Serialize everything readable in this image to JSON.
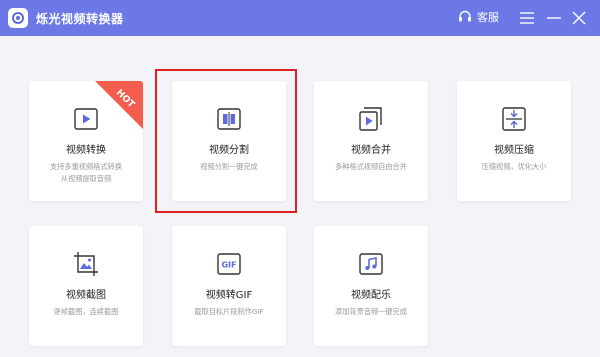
{
  "app": {
    "title": "烁光视频转换器"
  },
  "titlebar": {
    "support_label": "客服"
  },
  "tools": [
    {
      "name": "视频转换",
      "desc": "支持多重视频格式转换\n从视频提取音频",
      "badge": "HOT"
    },
    {
      "name": "视频分割",
      "desc": "视频分割一键完成"
    },
    {
      "name": "视频合并",
      "desc": "多种格式视频自由合并"
    },
    {
      "name": "视频压缩",
      "desc": "压缩视频，优化大小"
    },
    {
      "name": "视频截图",
      "desc": "逐帧截图，连续截图"
    },
    {
      "name": "视频转GIF",
      "desc": "截取目标片段制作GIF",
      "icon_text": "GIF"
    },
    {
      "name": "视频配乐",
      "desc": "添加背景音频一键完成"
    }
  ],
  "colors": {
    "titlebar": "#6b78e6",
    "accent": "#5d6ae0",
    "hot": "#f35d4e",
    "selection": "#e02020"
  }
}
